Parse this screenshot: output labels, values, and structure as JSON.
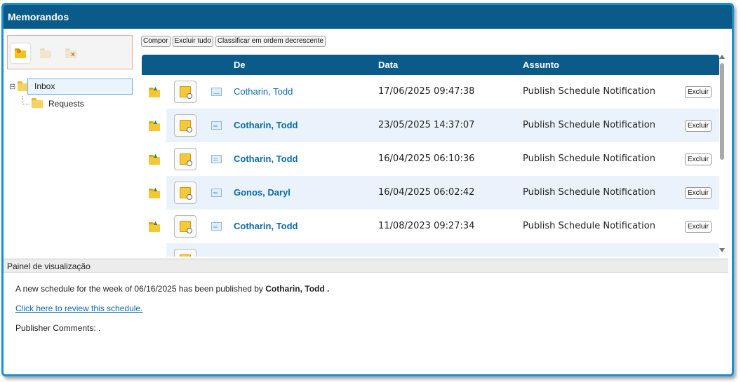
{
  "window": {
    "title": "Memorandos"
  },
  "folder_toolbar": {
    "icons": [
      "new-folder-icon",
      "edit-folder-icon",
      "delete-folder-icon"
    ],
    "colors": {
      "active": "#f0b400",
      "disabled": "#e6dcc0",
      "delete_mark": "#d9534f"
    }
  },
  "tree": {
    "items": [
      {
        "label": "Inbox",
        "selected": true
      },
      {
        "label": "Requests",
        "selected": false
      }
    ]
  },
  "actions": {
    "compose": "Compor",
    "delete_all": "Excluir tudo",
    "sort": "Classificar em ordem decrescente"
  },
  "table": {
    "headers": {
      "from": "De",
      "date": "Data",
      "subject": "Assunto"
    },
    "rows": [
      {
        "from": "Cotharin, Todd",
        "date": "17/06/2025 09:47:38",
        "subject": "Publish Schedule Notification",
        "delete": "Excluir",
        "unread": false
      },
      {
        "from": "Cotharin, Todd",
        "date": "23/05/2025 14:37:07",
        "subject": "Publish Schedule Notification",
        "delete": "Excluir",
        "unread": true
      },
      {
        "from": "Cotharin, Todd",
        "date": "16/04/2025 06:10:36",
        "subject": "Publish Schedule Notification",
        "delete": "Excluir",
        "unread": true
      },
      {
        "from": "Gonos, Daryl",
        "date": "16/04/2025 06:02:42",
        "subject": "Publish Schedule Notification",
        "delete": "Excluir",
        "unread": true
      },
      {
        "from": "Cotharin, Todd",
        "date": "11/08/2023 09:27:34",
        "subject": "Publish Schedule Notification",
        "delete": "Excluir",
        "unread": true
      }
    ]
  },
  "preview": {
    "title": "Painel de visualização",
    "line1_prefix": "A new schedule for the week of 06/16/2025 has been published by",
    "line1_author": "Cotharin, Todd",
    "line1_suffix": ".",
    "link": "Click here to review this schedule.",
    "comments": "Publisher Comments: ."
  },
  "colors": {
    "header_bg": "#0a5a8a",
    "window_border": "#1a8fd0",
    "link": "#0a6aaa",
    "row_alt": "#eaf3fb"
  }
}
